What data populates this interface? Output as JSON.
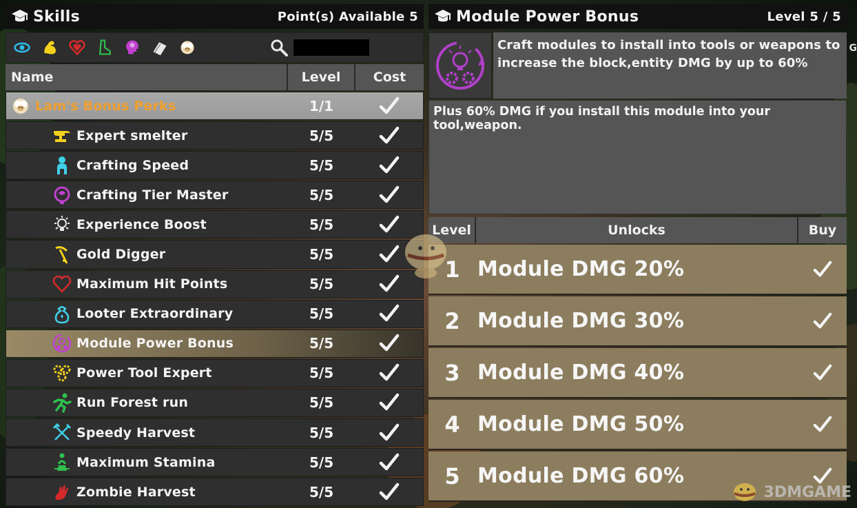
{
  "skills_panel": {
    "title": "Skills",
    "points_available": "Point(s) Available 5",
    "categories": [
      {
        "name": "eye-icon",
        "color": "#2fb8e6"
      },
      {
        "name": "strength-arm-icon",
        "color": "#f4d21c"
      },
      {
        "name": "heart-icon",
        "color": "#d42a2a"
      },
      {
        "name": "boot-icon",
        "color": "#2fbf4c"
      },
      {
        "name": "brain-head-icon",
        "color": "#c040d0"
      },
      {
        "name": "book-icon",
        "color": "#e8e8e8"
      },
      {
        "name": "sheep-icon",
        "color": "#d8b070"
      }
    ],
    "search_placeholder": "",
    "columns": {
      "name": "Name",
      "level": "Level",
      "cost": "Cost"
    },
    "rows": [
      {
        "label": "Lam's Bonus Perks",
        "level": "1/1",
        "icon": "sheep-icon",
        "icon_color": "#d8b070",
        "group": true
      },
      {
        "label": "Expert smelter",
        "level": "5/5",
        "icon": "anvil-icon",
        "icon_color": "#f4d21c"
      },
      {
        "label": "Crafting Speed",
        "level": "5/5",
        "icon": "person-icon",
        "icon_color": "#3fd0e8"
      },
      {
        "label": "Crafting Tier Master",
        "level": "5/5",
        "icon": "brain-icon",
        "icon_color": "#c040d0"
      },
      {
        "label": "Experience Boost",
        "level": "5/5",
        "icon": "lightbulb-icon",
        "icon_color": "#e8e8e8"
      },
      {
        "label": "Gold Digger",
        "level": "5/5",
        "icon": "pickaxe-icon",
        "icon_color": "#f4d21c"
      },
      {
        "label": "Maximum Hit Points",
        "level": "5/5",
        "icon": "heart-outline-icon",
        "icon_color": "#d42a2a"
      },
      {
        "label": "Looter Extraordinary",
        "level": "5/5",
        "icon": "loot-bag-icon",
        "icon_color": "#3fd0e8"
      },
      {
        "label": "Module Power Bonus",
        "level": "5/5",
        "icon": "module-gear-icon",
        "icon_color": "#c040d0",
        "selected": true
      },
      {
        "label": "Power Tool Expert",
        "level": "5/5",
        "icon": "gears-icon",
        "icon_color": "#f4d21c"
      },
      {
        "label": "Run Forest run",
        "level": "5/5",
        "icon": "runner-icon",
        "icon_color": "#2fbf4c"
      },
      {
        "label": "Speedy Harvest",
        "level": "5/5",
        "icon": "crossed-tools-icon",
        "icon_color": "#3fd0e8"
      },
      {
        "label": "Maximum Stamina",
        "level": "5/5",
        "icon": "stamina-icon",
        "icon_color": "#2fbf4c"
      },
      {
        "label": "Zombie Harvest",
        "level": "5/5",
        "icon": "zombie-hand-icon",
        "icon_color": "#d42a2a"
      }
    ]
  },
  "detail_panel": {
    "title": "Module Power Bonus",
    "level": "Level 5 / 5",
    "short_description": "Craft modules to install into tools or weapons to increase the block,entity DMG by up to 60%",
    "long_description": "Plus 60% DMG if you install this module into your tool,weapon.",
    "columns": {
      "level": "Level",
      "unlocks": "Unlocks",
      "buy": "Buy"
    },
    "unlocks": [
      {
        "level": "1",
        "label": "Module DMG 20%"
      },
      {
        "level": "2",
        "label": "Module DMG 30%"
      },
      {
        "level": "3",
        "label": "Module DMG 40%"
      },
      {
        "level": "4",
        "label": "Module DMG 50%"
      },
      {
        "level": "5",
        "label": "Module DMG 60%"
      }
    ]
  },
  "edge_text": "G",
  "watermark": "3DMGAME"
}
